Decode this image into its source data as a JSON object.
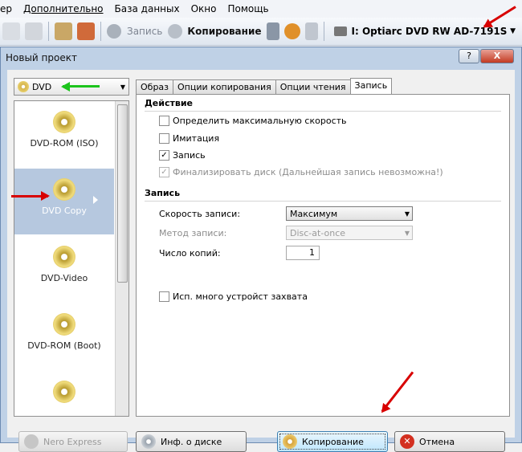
{
  "menu": [
    "ер",
    "Дополнительно",
    "База данных",
    "Окно",
    "Помощь"
  ],
  "toolbar": {
    "record_label": "Запись",
    "copy_label": "Копирование",
    "drive_label": "I: Optiarc DVD RW AD-7191S"
  },
  "dialog": {
    "title": "Новый проект",
    "help_btn": "?",
    "close_btn": "X"
  },
  "media_select": "DVD",
  "project_types": [
    "DVD-ROM (ISO)",
    "DVD Copy",
    "DVD-Video",
    "DVD-ROM (Boot)"
  ],
  "selected_type": "DVD Copy",
  "tabs": [
    "Образ",
    "Опции копирования",
    "Опции чтения",
    "Запись"
  ],
  "active_tab": "Запись",
  "action_section": {
    "title": "Действие",
    "options": [
      {
        "label": "Определить максимальную скорость",
        "checked": false,
        "disabled": false
      },
      {
        "label": "Имитация",
        "checked": false,
        "disabled": false
      },
      {
        "label": "Запись",
        "checked": true,
        "disabled": false
      },
      {
        "label": "Финализировать диск (Дальнейшая запись невозможна!)",
        "checked": true,
        "disabled": true
      }
    ]
  },
  "write_section": {
    "title": "Запись",
    "speed_label": "Скорость записи:",
    "speed_value": "Максимум",
    "method_label": "Метод записи:",
    "method_value": "Disc-at-once",
    "copies_label": "Число копий:",
    "copies_value": "1",
    "multi_label": "Исп. много устройст захвата"
  },
  "buttons": {
    "nero_express": "Nero Express",
    "disc_info": "Инф. о диске",
    "copy": "Копирование",
    "cancel": "Отмена"
  },
  "colors": {
    "annotation_red": "#d80000",
    "annotation_green": "#1cc41c",
    "selection": "#b6c8df"
  }
}
